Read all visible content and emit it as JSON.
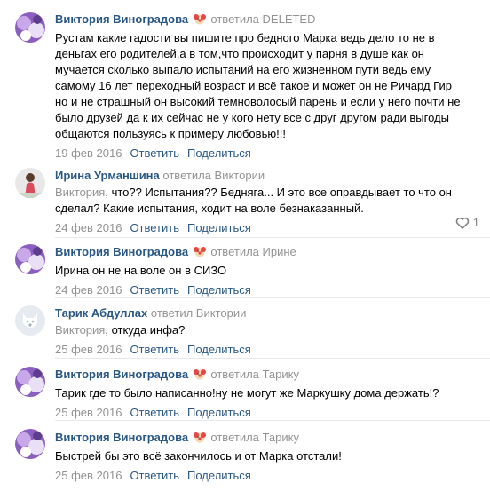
{
  "comments": [
    {
      "author": "Виктория Виноградова",
      "badge_icon": "clown-face-icon",
      "reply_verb": "ответила",
      "reply_target": "DELETED",
      "addressee": "",
      "text_lines": [
        "Рустам какие гадости вы пишите про бедного Марка ведь дело то не в",
        "деньгах его родителей,а в том,что происходит у парня в душе как он",
        "мучается сколько выпало испытаний на его жизненном пути ведь ему",
        "самому 16 лет переходный возраст и всё такое и может он не Ричард Гир",
        "но и не страшный он высокий темноволосый парень и если у него почти не",
        "было друзей да к их сейчас не у кого нету все с друг другом ради выгоды",
        "общаются пользуясь к примеру любовью!!!"
      ],
      "date": "19 фев 2016",
      "reply_label": "Ответить",
      "share_label": "Поделиться",
      "likes": ""
    },
    {
      "author": "Ирина Урманшина",
      "badge_icon": "",
      "reply_verb": "ответила",
      "reply_target": "Виктории",
      "addressee": "Виктория",
      "text_lines": [
        ", что?? Испытания?? Бедняга... И это все оправдывает то что он",
        "сделал? Какие испытания, ходит на воле безнаказанный."
      ],
      "date": "24 фев 2016",
      "reply_label": "Ответить",
      "share_label": "Поделиться",
      "likes": "1"
    },
    {
      "author": "Виктория Виноградова",
      "badge_icon": "clown-face-icon",
      "reply_verb": "ответила",
      "reply_target": "Ирине",
      "addressee": "",
      "text_lines": [
        "Ирина он не на воле он в СИЗО"
      ],
      "date": "24 фев 2016",
      "reply_label": "Ответить",
      "share_label": "Поделиться",
      "likes": ""
    },
    {
      "author": "Тарик Абдуллах",
      "badge_icon": "",
      "reply_verb": "ответил",
      "reply_target": "Виктории",
      "addressee": "Виктория",
      "text_lines": [
        ", откуда инфа?"
      ],
      "date": "25 фев 2016",
      "reply_label": "Ответить",
      "share_label": "Поделиться",
      "likes": ""
    },
    {
      "author": "Виктория Виноградова",
      "badge_icon": "clown-face-icon",
      "reply_verb": "ответила",
      "reply_target": "Тарику",
      "addressee": "",
      "text_lines": [
        "Тарик где то было написанно!ну не могут же Маркушку дома держать!?"
      ],
      "date": "25 фев 2016",
      "reply_label": "Ответить",
      "share_label": "Поделиться",
      "likes": ""
    },
    {
      "author": "Виктория Виноградова",
      "badge_icon": "clown-face-icon",
      "reply_verb": "ответила",
      "reply_target": "Тарику",
      "addressee": "",
      "text_lines": [
        "Быстрей бы это всё закончилось и от Марка отстали!"
      ],
      "date": "25 фев 2016",
      "reply_label": "Ответить",
      "share_label": "Поделиться",
      "likes": ""
    }
  ],
  "colors": {
    "author": "#2a5885",
    "meta": "#939393",
    "divider": "#e7e8ec"
  }
}
